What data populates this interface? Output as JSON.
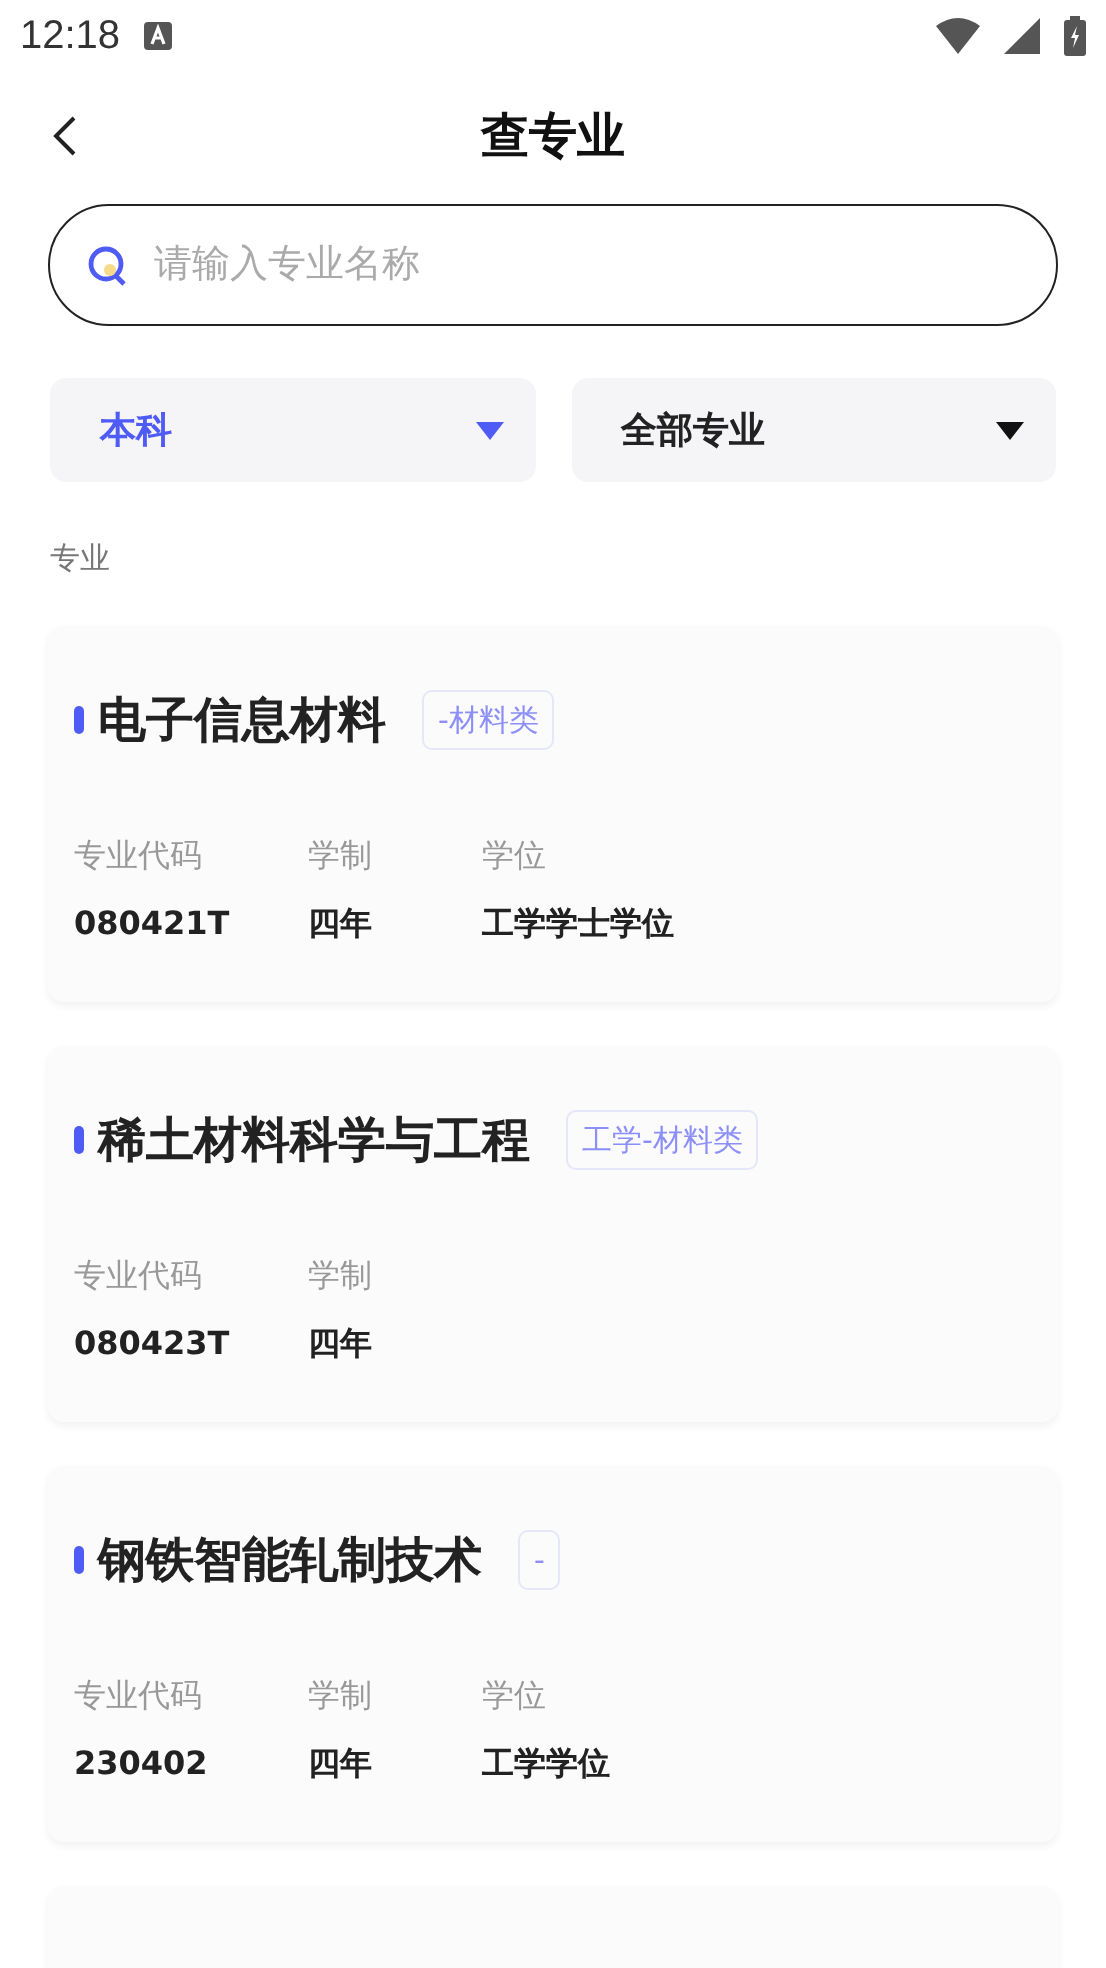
{
  "status_bar": {
    "time": "12:18"
  },
  "header": {
    "title": "查专业"
  },
  "search": {
    "placeholder": "请输入专业名称"
  },
  "filters": [
    {
      "label": "本科",
      "selected": true
    },
    {
      "label": "全部专业",
      "selected": false
    }
  ],
  "section_label": "专业",
  "majors": [
    {
      "name": "电子信息材料",
      "tag": "-材料类",
      "fields": [
        {
          "label": "专业代码",
          "value": "080421T"
        },
        {
          "label": "学制",
          "value": "四年"
        },
        {
          "label": "学位",
          "value": "工学学士学位"
        }
      ]
    },
    {
      "name": "稀土材料科学与工程",
      "tag": "工学-材料类",
      "fields": [
        {
          "label": "专业代码",
          "value": "080423T"
        },
        {
          "label": "学制",
          "value": "四年"
        }
      ]
    },
    {
      "name": "钢铁智能轧制技术",
      "tag": "-",
      "fields": [
        {
          "label": "专业代码",
          "value": "230402"
        },
        {
          "label": "学制",
          "value": "四年"
        },
        {
          "label": "学位",
          "value": "工学学位"
        }
      ]
    },
    {
      "kind": "clipped"
    }
  ]
}
